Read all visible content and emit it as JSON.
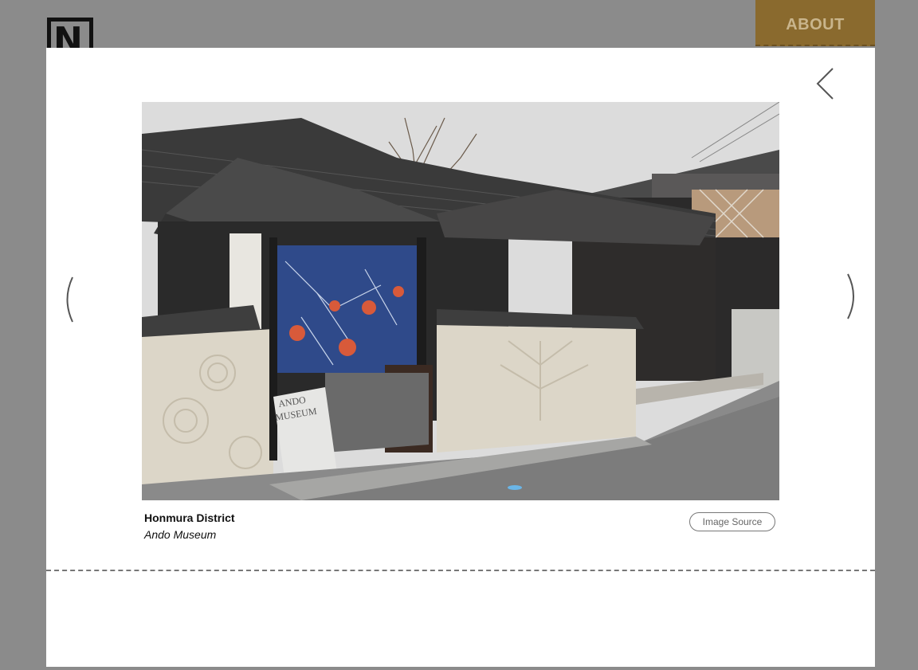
{
  "header": {
    "logo_letter": "N",
    "about_label": "ABOUT"
  },
  "lightbox": {
    "close_icon": "close-chevron-icon",
    "prev_icon": "chevron-left-icon",
    "next_icon": "chevron-right-icon",
    "image": {
      "alt": "Ando Museum entrance gate with blue noren curtain and plaster walls",
      "sign_text_1": "ANDO",
      "sign_text_2": "MUSEUM"
    },
    "caption": {
      "title": "Honmura District",
      "subtitle": "Ando Museum"
    },
    "source_label": "Image Source"
  },
  "colors": {
    "backdrop": "#8b8b8b",
    "about_tab": "#8a6a2e",
    "about_text": "#c9b58c",
    "modal": "#ffffff"
  }
}
